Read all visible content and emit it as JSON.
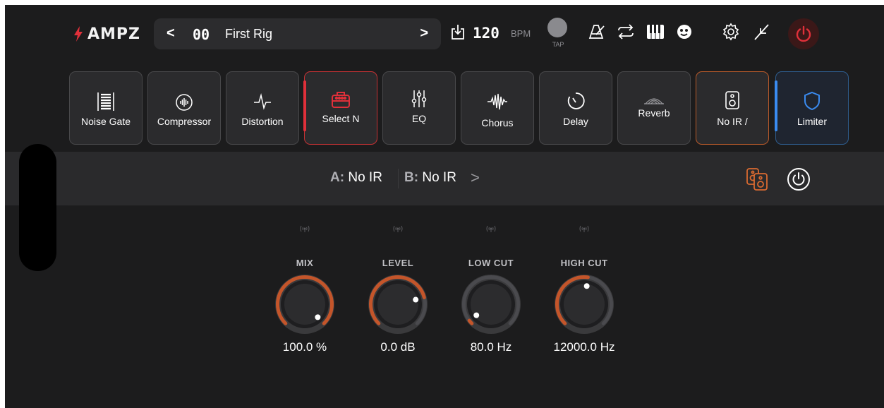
{
  "topbar": {
    "logo_text": "AMPZ",
    "preset_prev": "<",
    "preset_number": "00",
    "preset_name": "First Rig",
    "preset_next": ">",
    "bpm_value": "120",
    "bpm_unit": "BPM",
    "tap_label": "TAP",
    "icons": [
      "import-icon",
      "metronome-icon",
      "loop-icon",
      "piano-icon",
      "theater-masks-icon",
      "settings-gear-icon",
      "tuner-fork-icon",
      "power-icon"
    ]
  },
  "chain": [
    {
      "label": "Noise Gate",
      "icon": "noise-gate-icon",
      "state": "normal"
    },
    {
      "label": "Compressor",
      "icon": "compressor-icon",
      "state": "normal"
    },
    {
      "label": "Distortion",
      "icon": "distortion-icon",
      "state": "normal"
    },
    {
      "label": "Select N",
      "icon": "amp-icon",
      "state": "selected"
    },
    {
      "label": "EQ",
      "icon": "eq-icon",
      "state": "normal"
    },
    {
      "label": "Chorus",
      "icon": "chorus-icon",
      "state": "normal"
    },
    {
      "label": "Delay",
      "icon": "delay-icon",
      "state": "normal"
    },
    {
      "label": "Reverb",
      "icon": "reverb-icon",
      "state": "normal"
    },
    {
      "label": "No IR /",
      "icon": "speaker-icon",
      "state": "ir"
    },
    {
      "label": "Limiter",
      "icon": "shield-icon",
      "state": "limiter"
    }
  ],
  "ir": {
    "a_key": "A:",
    "a_value": "No IR",
    "b_key": "B:",
    "b_value": "No IR",
    "chevron": ">"
  },
  "knobs": [
    {
      "label": "MIX",
      "value": "100.0 %",
      "level": 1.0
    },
    {
      "label": "LEVEL",
      "value": "0.0 dB",
      "level": 0.78
    },
    {
      "label": "LOW CUT",
      "value": "80.0 Hz",
      "level": 0.03
    },
    {
      "label": "HIGH CUT",
      "value": "12000.0 Hz",
      "level": 0.53
    }
  ],
  "colors": {
    "accent_red": "#e0303a",
    "knob_arc": "#c4552a",
    "ir_orange": "#d96a30",
    "limiter_blue": "#3a8bf0"
  }
}
